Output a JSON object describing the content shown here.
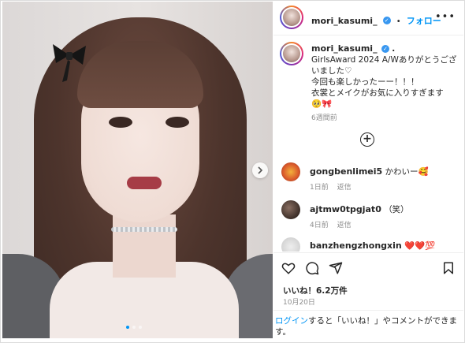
{
  "post": {
    "username": "mori_kasumi_",
    "follow_label": "フォロー",
    "separator": "•",
    "caption_lines": [
      "GirlsAward 2024 A/Wありがとうござ",
      "いました♡",
      "今回も楽しかったーー！！！",
      "衣裳とメイクがお気に入りすぎます",
      "🥺🎀"
    ],
    "caption_time": "6週間前",
    "likes": "いいね！6.2万件",
    "date": "10月20日",
    "login_link": "ログイン",
    "login_text": "すると「いいね！」やコメントができます。",
    "carousel": {
      "count": 3,
      "active_index": 0
    }
  },
  "comments": [
    {
      "user": "gongbenlimei5",
      "text": "かわいー🥰",
      "time": "1日前",
      "reply": "返信"
    },
    {
      "user": "ajtmw0tpgjat0",
      "text": "（笑）",
      "time": "4日前",
      "reply": "返信"
    },
    {
      "user": "banzhengzhongxin",
      "text": "❤️❤️💯",
      "time": "",
      "reply": ""
    }
  ],
  "icons": {
    "more": "more-options-icon",
    "next": "chevron-right-icon",
    "add": "add-circle-icon",
    "like": "heart-icon",
    "comment": "comment-icon",
    "share": "share-icon",
    "save": "bookmark-icon",
    "verified": "verified-badge-icon"
  },
  "colors": {
    "accent": "#0095f6",
    "text": "#262626",
    "muted": "#8e8e8e",
    "verified": "#3897f0"
  }
}
